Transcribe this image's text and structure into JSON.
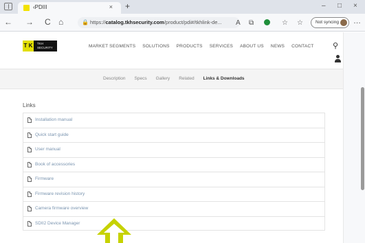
{
  "browser": {
    "tab_title": "‹PDIII",
    "tab_close": "×",
    "new_tab": "+",
    "window_controls": [
      "–",
      "□",
      "×"
    ],
    "url_host": "catalog.tkhsecurity.com",
    "url_prefix": "https://",
    "url_path": "/product/pdi#/tkhlink-de...",
    "profile_label": "Not syncing"
  },
  "icons": {
    "back": "←",
    "forward": "→",
    "reload": "C",
    "home": "⌂",
    "lock": "🔒",
    "reading": "A",
    "tab_actions": "⧉",
    "favorite": "☆",
    "collections": "☆",
    "more": "…",
    "search": "⚲"
  },
  "colors": {
    "brand_yellow": "#e2de00",
    "arrow_green": "#c6d200",
    "link_blue": "#7b95b0"
  },
  "site": {
    "logo_mark": "T K",
    "logo_text": "TKH SECURITY",
    "nav": [
      "MARKET SEGMENTS",
      "SOLUTIONS",
      "PRODUCTS",
      "SERVICES",
      "ABOUT US",
      "NEWS",
      "CONTACT"
    ]
  },
  "subnav": {
    "items": [
      "Description",
      "Specs",
      "Gallery",
      "Related",
      "Links & Downloads"
    ],
    "active_index": 4
  },
  "links": {
    "title": "Links",
    "items": [
      "Installation manual",
      "Quick start guide",
      "User manual",
      "Book of accessories",
      "Firmware",
      "Firmware revision history",
      "Camera firmware overview",
      "SDII2 Device Manager"
    ]
  }
}
